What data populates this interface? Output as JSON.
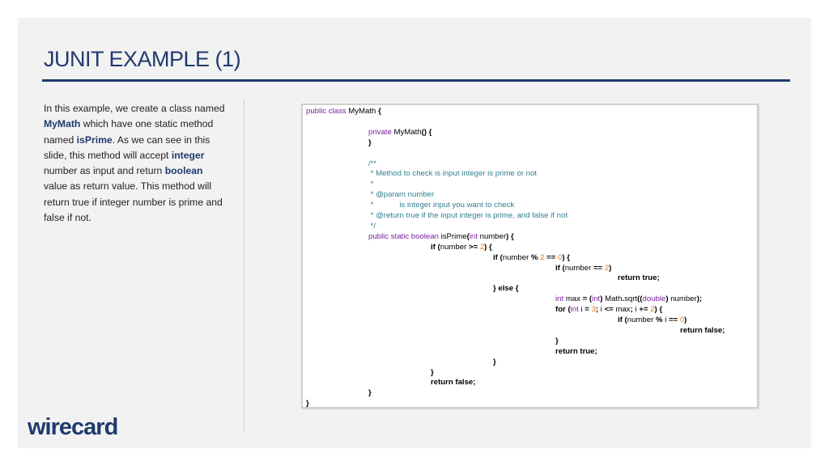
{
  "slide": {
    "title": "JUNIT EXAMPLE (1)",
    "description_parts": [
      {
        "text": "In this example, we create a class named ",
        "bold": false
      },
      {
        "text": "MyMath",
        "bold": true
      },
      {
        "text": " which have one static method named ",
        "bold": false
      },
      {
        "text": "isPrime",
        "bold": true
      },
      {
        "text": ". As we can see in this slide, this method will accept ",
        "bold": false
      },
      {
        "text": "integer",
        "bold": true
      },
      {
        "text": " number as input and return ",
        "bold": false
      },
      {
        "text": "boolean",
        "bold": true
      },
      {
        "text": " value as return value. This method will return true if integer number is prime and false if not.",
        "bold": false
      }
    ],
    "logo_text": "wirecard"
  },
  "code": [
    {
      "indent": 0,
      "parts": [
        {
          "t": "public class ",
          "c": "kw"
        },
        {
          "t": "MyMath ",
          "c": "plain"
        },
        {
          "t": "{",
          "c": "bold"
        }
      ]
    },
    {
      "indent": 1,
      "parts": []
    },
    {
      "indent": 1,
      "parts": [
        {
          "t": "private ",
          "c": "kw"
        },
        {
          "t": "MyMath",
          "c": "plain"
        },
        {
          "t": "() {",
          "c": "bold"
        }
      ]
    },
    {
      "indent": 1,
      "parts": [
        {
          "t": "}",
          "c": "bold"
        }
      ]
    },
    {
      "indent": 1,
      "parts": []
    },
    {
      "indent": 1,
      "parts": [
        {
          "t": "/**",
          "c": "cm"
        }
      ]
    },
    {
      "indent": 1,
      "parts": [
        {
          "t": " * Method to check is input integer is prime or not",
          "c": "cm"
        }
      ]
    },
    {
      "indent": 1,
      "parts": [
        {
          "t": " *",
          "c": "cm"
        }
      ]
    },
    {
      "indent": 1,
      "parts": [
        {
          "t": " * @param number",
          "c": "cm"
        }
      ]
    },
    {
      "indent": 1,
      "parts": [
        {
          "t": " *            is integer input you want to check",
          "c": "cm"
        }
      ]
    },
    {
      "indent": 1,
      "parts": [
        {
          "t": " * @return true if the input integer is prime, and false if not",
          "c": "cm"
        }
      ]
    },
    {
      "indent": 1,
      "parts": [
        {
          "t": " */",
          "c": "cm"
        }
      ]
    },
    {
      "indent": 1,
      "parts": [
        {
          "t": "public static boolean ",
          "c": "kw"
        },
        {
          "t": "isPrime",
          "c": "plain"
        },
        {
          "t": "(",
          "c": "bold"
        },
        {
          "t": "int ",
          "c": "kw"
        },
        {
          "t": "number",
          "c": "plain"
        },
        {
          "t": ") {",
          "c": "bold"
        }
      ]
    },
    {
      "indent": 2,
      "parts": [
        {
          "t": "if ",
          "c": "bold"
        },
        {
          "t": "(",
          "c": "bold"
        },
        {
          "t": "number ",
          "c": "plain"
        },
        {
          "t": ">= ",
          "c": "bold"
        },
        {
          "t": "2",
          "c": "num"
        },
        {
          "t": ") {",
          "c": "bold"
        }
      ]
    },
    {
      "indent": 3,
      "parts": [
        {
          "t": "if ",
          "c": "bold"
        },
        {
          "t": "(",
          "c": "bold"
        },
        {
          "t": "number ",
          "c": "plain"
        },
        {
          "t": "% ",
          "c": "bold"
        },
        {
          "t": "2 ",
          "c": "num"
        },
        {
          "t": "== ",
          "c": "bold"
        },
        {
          "t": "0",
          "c": "num"
        },
        {
          "t": ") {",
          "c": "bold"
        }
      ]
    },
    {
      "indent": 4,
      "parts": [
        {
          "t": "if ",
          "c": "bold"
        },
        {
          "t": "(",
          "c": "bold"
        },
        {
          "t": "number ",
          "c": "plain"
        },
        {
          "t": "== ",
          "c": "bold"
        },
        {
          "t": "2",
          "c": "num"
        },
        {
          "t": ")",
          "c": "bold"
        }
      ]
    },
    {
      "indent": 5,
      "parts": [
        {
          "t": "return true;",
          "c": "bold"
        }
      ]
    },
    {
      "indent": 3,
      "parts": [
        {
          "t": "} else {",
          "c": "bold"
        }
      ]
    },
    {
      "indent": 4,
      "parts": [
        {
          "t": "int ",
          "c": "kw"
        },
        {
          "t": "max ",
          "c": "plain"
        },
        {
          "t": "= (",
          "c": "bold"
        },
        {
          "t": "int",
          "c": "kw"
        },
        {
          "t": ") ",
          "c": "bold"
        },
        {
          "t": "Math",
          "c": "plain"
        },
        {
          "t": ".",
          "c": "bold"
        },
        {
          "t": "sqrt",
          "c": "plain"
        },
        {
          "t": "((",
          "c": "bold"
        },
        {
          "t": "double",
          "c": "kw"
        },
        {
          "t": ") ",
          "c": "bold"
        },
        {
          "t": "number",
          "c": "plain"
        },
        {
          "t": ");",
          "c": "bold"
        }
      ]
    },
    {
      "indent": 4,
      "parts": [
        {
          "t": "for ",
          "c": "bold"
        },
        {
          "t": "(",
          "c": "bold"
        },
        {
          "t": "int ",
          "c": "kw"
        },
        {
          "t": "i ",
          "c": "plain"
        },
        {
          "t": "= ",
          "c": "bold"
        },
        {
          "t": "3",
          "c": "num"
        },
        {
          "t": "; ",
          "c": "bold"
        },
        {
          "t": "i ",
          "c": "plain"
        },
        {
          "t": "<= ",
          "c": "bold"
        },
        {
          "t": "max",
          "c": "plain"
        },
        {
          "t": "; ",
          "c": "bold"
        },
        {
          "t": "i ",
          "c": "plain"
        },
        {
          "t": "+= ",
          "c": "bold"
        },
        {
          "t": "2",
          "c": "num"
        },
        {
          "t": ") {",
          "c": "bold"
        }
      ]
    },
    {
      "indent": 5,
      "parts": [
        {
          "t": "if ",
          "c": "bold"
        },
        {
          "t": "(",
          "c": "bold"
        },
        {
          "t": "number ",
          "c": "plain"
        },
        {
          "t": "% ",
          "c": "bold"
        },
        {
          "t": "i ",
          "c": "plain"
        },
        {
          "t": "== ",
          "c": "bold"
        },
        {
          "t": "0",
          "c": "num"
        },
        {
          "t": ")",
          "c": "bold"
        }
      ]
    },
    {
      "indent": 6,
      "parts": [
        {
          "t": "return false;",
          "c": "bold"
        }
      ]
    },
    {
      "indent": 4,
      "parts": [
        {
          "t": "}",
          "c": "bold"
        }
      ]
    },
    {
      "indent": 4,
      "parts": [
        {
          "t": "return true;",
          "c": "bold"
        }
      ]
    },
    {
      "indent": 3,
      "parts": [
        {
          "t": "}",
          "c": "bold"
        }
      ]
    },
    {
      "indent": 2,
      "parts": [
        {
          "t": "}",
          "c": "bold"
        }
      ]
    },
    {
      "indent": 2,
      "parts": [
        {
          "t": "return false;",
          "c": "bold"
        }
      ]
    },
    {
      "indent": 1,
      "parts": [
        {
          "t": "}",
          "c": "bold"
        }
      ]
    },
    {
      "indent": 0,
      "parts": [
        {
          "t": "}",
          "c": "bold"
        }
      ]
    }
  ]
}
